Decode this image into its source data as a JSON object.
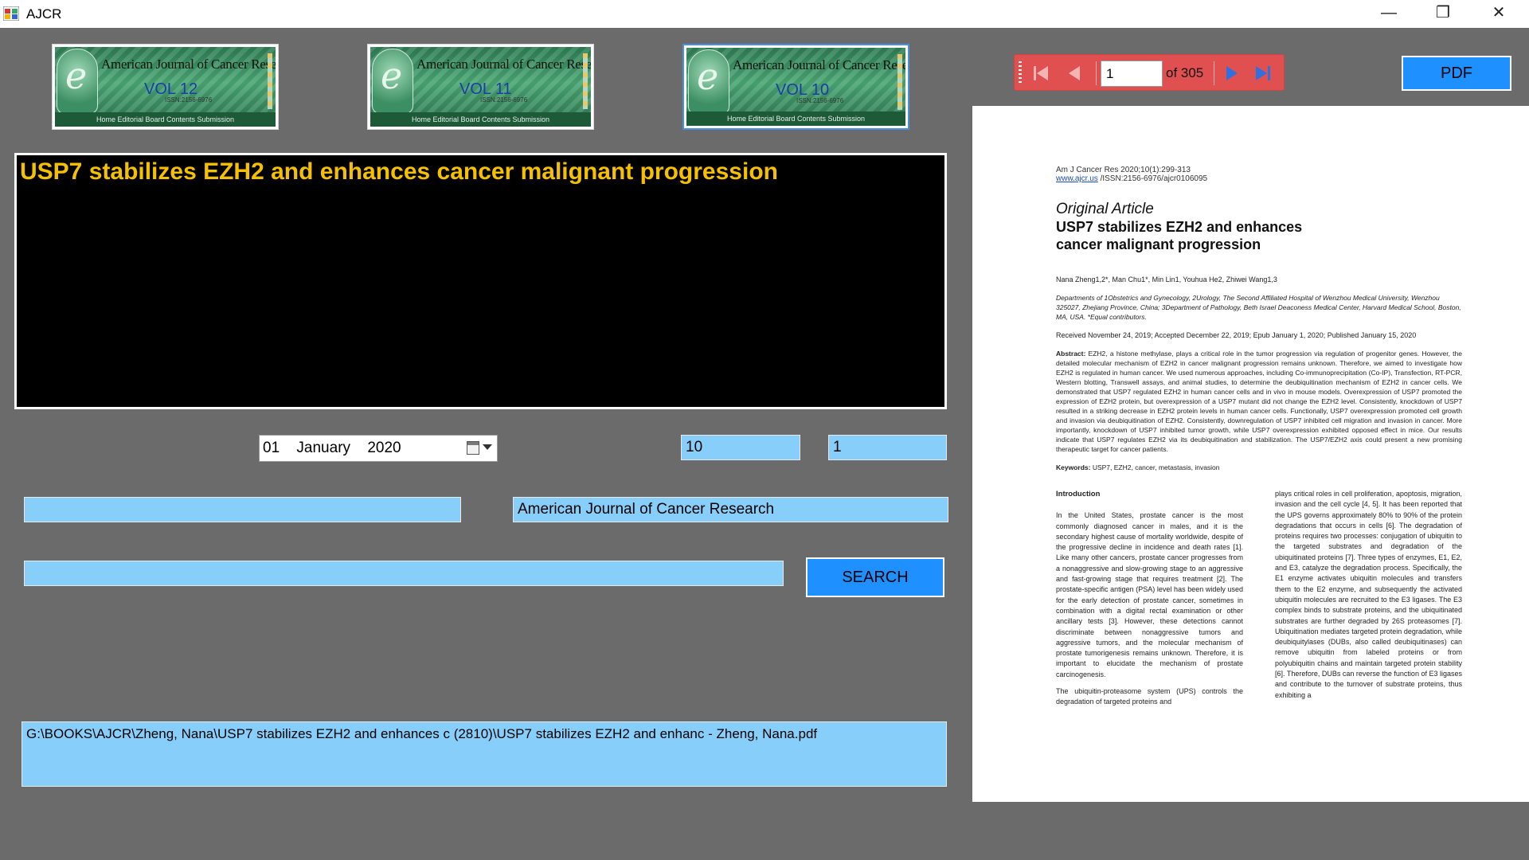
{
  "window": {
    "title": "AJCR",
    "min": "—",
    "max": "❐",
    "close": "✕"
  },
  "volumes": [
    {
      "journal": "American Journal of Cancer Research",
      "vol": "VOL 12",
      "issn": "ISSN:2156-6976",
      "nav": "Home  Editorial Board  Contents  Submission"
    },
    {
      "journal": "American Journal of Cancer Research",
      "vol": "VOL 11",
      "issn": "ISSN:2156-6976",
      "nav": "Home  Editorial Board  Contents  Submission"
    },
    {
      "journal": "American Journal of Cancer Research",
      "vol": "VOL 10",
      "issn": "ISSN:2156-6976",
      "nav": "Home  Editorial Board  Contents  Submission"
    }
  ],
  "article_title": "USP7 stabilizes EZH2 and enhances cancer malignant progression",
  "date": {
    "day": "01",
    "month": "January",
    "year": "2020"
  },
  "volume_field": "10",
  "issue_field": "1",
  "author_field": "",
  "journal_field": "American Journal of Cancer Research",
  "search_field": "",
  "search_button": "SEARCH",
  "file_path": "G:\\BOOKS\\AJCR\\Zheng, Nana\\USP7 stabilizes EZH2 and enhances c (2810)\\USP7 stabilizes EZH2 and enhanc - Zheng, Nana.pdf",
  "pdf_button": "PDF",
  "pdf_toolbar": {
    "page": "1",
    "of_label": "of 305"
  },
  "pdf_page": {
    "citation": "Am J Cancer Res 2020;10(1):299-313",
    "link": "www.ajcr.us",
    "issn": " /ISSN:2156-6976/ajcr0106095",
    "article_type": "Original Article",
    "title": "USP7 stabilizes EZH2 and enhances cancer malignant progression",
    "authors": "Nana Zheng1,2*, Man Chu1*, Min Lin1, Youhua He2, Zhiwei Wang1,3",
    "affiliations": "Departments of 1Obstetrics and Gynecology, 2Urology, The Second Affiliated Hospital of Wenzhou Medical University, Wenzhou 325027, Zhejiang Province, China; 3Department of Pathology, Beth Israel Deaconess Medical Center, Harvard Medical School, Boston, MA, USA. *Equal contributors.",
    "received": "Received November 24, 2019; Accepted December 22, 2019; Epub January 1, 2020; Published January 15, 2020",
    "abstract_label": "Abstract:",
    "abstract": " EZH2, a histone methylase, plays a critical role in the tumor progression via regulation of progenitor genes. However, the detailed molecular mechanism of EZH2 in cancer malignant progression remains unknown. Therefore, we aimed to investigate how EZH2 is regulated in human cancer. We used numerous approaches, including Co-immunoprecipitation (Co-IP), Transfection, RT-PCR, Western blotting, Transwell assays, and animal studies, to determine the deubiquitination mechanism of EZH2 in cancer cells. We demonstrated that USP7 regulated EZH2 in human cancer cells and in vivo in mouse models. Overexpression of USP7 promoted the expression of EZH2 protein, but overexpression of a USP7 mutant did not change the EZH2 level. Consistently, knockdown of USP7 resulted in a striking decrease in EZH2 protein levels in human cancer cells. Functionally, USP7 overexpression promoted cell growth and invasion via deubiquitination of EZH2. Consistently, downregulation of USP7 inhibited cell migration and invasion in cancer. More importantly, knockdown of USP7 inhibited tumor growth, while USP7 overexpression exhibited opposed effect in mice. Our results indicate that USP7 regulates EZH2 via its deubiquitination and stabilization. The USP7/EZH2 axis could present a new promising therapeutic target for cancer patients.",
    "keywords_label": "Keywords:",
    "keywords": " USP7, EZH2, cancer, metastasis, invasion",
    "intro_heading": "Introduction",
    "intro_p1": "In the United States, prostate cancer is the most commonly diagnosed cancer in males, and it is the secondary highest cause of mortality worldwide, despite of the progressive decline in incidence and death rates [1]. Like many other cancers, prostate cancer progresses from a nonaggressive and slow-growing stage to an aggressive and fast-growing stage that requires treatment [2]. The prostate-specific antigen (PSA) level has been widely used for the early detection of prostate cancer, sometimes in combination with a digital rectal examination or other ancillary tests [3]. However, these detections cannot discriminate between nonaggressive tumors and aggressive tumors, and the molecular mechanism of prostate tumorigenesis remains unknown. Therefore, it is important to elucidate the mechanism of prostate carcinogenesis.",
    "intro_p2": "The ubiquitin-proteasome system (UPS) controls the degradation of targeted proteins and",
    "col2_p1": "plays critical roles in cell proliferation, apoptosis, migration, invasion and the cell cycle [4, 5]. It has been reported that the UPS governs approximately 80% to 90% of the protein degradations that occurs in cells [6]. The degradation of proteins requires two processes: conjugation of ubiquitin to the targeted substrates and degradation of the ubiquitinated proteins [7]. Three types of enzymes, E1, E2, and E3, catalyze the degradation process. Specifically, the E1 enzyme activates ubiquitin molecules and transfers them to the E2 enzyme, and subsequently the activated ubiquitin molecules are recruited to the E3 ligases. The E3 complex binds to substrate proteins, and the ubiquitinated substrates are further degraded by 26S proteasomes [7]. Ubiquitination mediates targeted protein degradation, while deubiquitylases (DUBs, also called deubiquitinases) can remove ubiquitin from labeled proteins or from polyubiquitin chains and maintain targeted protein stability [6]. Therefore, DUBs can reverse the function of E3 ligases and contribute to the turnover of substrate proteins, thus exhibiting a"
  },
  "colors": {
    "background": "#6b6b6b",
    "field": "#87cefa",
    "button": "#1e90ff",
    "title_text": "#f5c000",
    "toolbar": "#e05050"
  }
}
